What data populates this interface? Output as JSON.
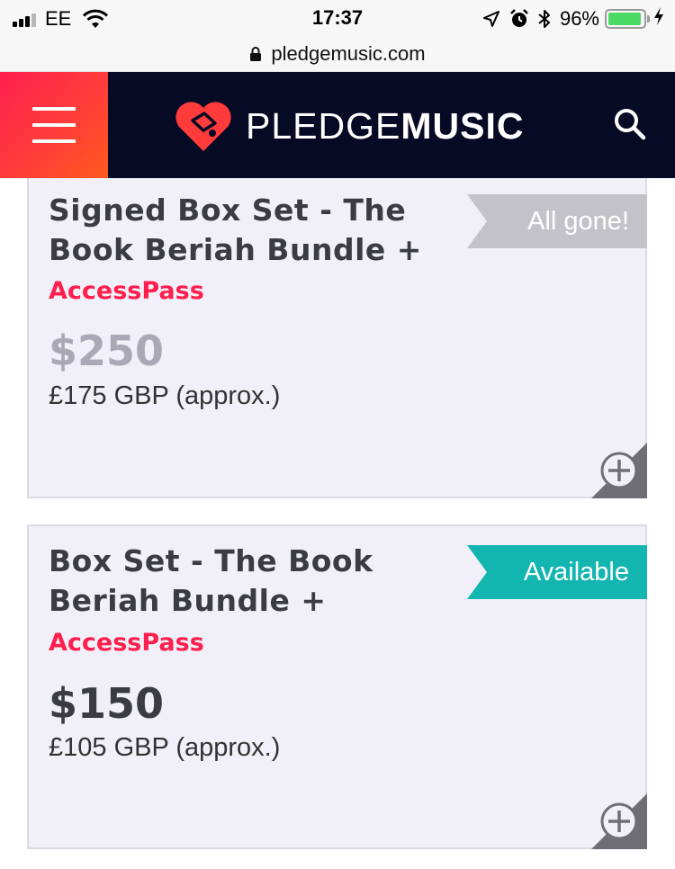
{
  "status_bar": {
    "carrier": "EE",
    "time": "17:37",
    "battery_percent": "96%",
    "battery_level": 0.96,
    "icons": [
      "signal-icon",
      "wifi-icon",
      "location-arrow-icon",
      "alarm-icon",
      "bluetooth-icon",
      "battery-icon",
      "charging-icon"
    ]
  },
  "browser": {
    "url": "pledgemusic.com"
  },
  "header": {
    "logo_light": "PLEDGE",
    "logo_bold": "MUSIC",
    "colors": {
      "background": "#070a24",
      "menu_gradient_start": "#ff1f4e",
      "menu_gradient_end": "#ff5a1e",
      "logo_heart": "#ff3b3b"
    }
  },
  "cards": [
    {
      "title_line1": "Signed Box Set - The",
      "title_line2": "Book Beriah Bundle +",
      "subtitle": "AccessPass",
      "price": "$250",
      "approx": "£175 GBP (approx.)",
      "status": "All gone!",
      "status_color": "#c3c2c9"
    },
    {
      "title_line1": "Box Set - The Book",
      "title_line2": "Beriah Bundle +",
      "subtitle": "AccessPass",
      "price": "$150",
      "approx": "£105 GBP (approx.)",
      "status": "Available",
      "status_color": "#12b5b0"
    }
  ]
}
